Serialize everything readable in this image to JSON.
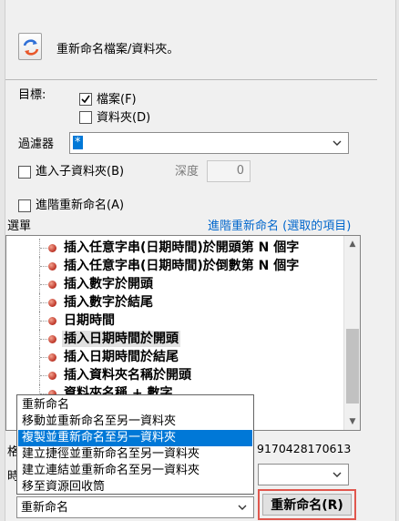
{
  "header": {
    "icon": "rename-refresh-icon",
    "title": "重新命名檔案/資料夾。"
  },
  "target": {
    "label": "目標:",
    "files_label": "檔案(F)",
    "files_checked": true,
    "folders_label": "資料夾(D)",
    "folders_checked": false
  },
  "filter": {
    "label": "過濾器",
    "value": "*"
  },
  "subfolders": {
    "label": "進入子資料夾(B)",
    "checked": false,
    "depth_label": "深度",
    "depth_value": "0"
  },
  "advanced": {
    "label": "進階重新命名(A)",
    "checked": false
  },
  "menu": {
    "label": "選單",
    "link": "進階重新命名 (選取的項目)",
    "items": [
      "插入任意字串(日期時間)於開頭第 N 個字",
      "插入任意字串(日期時間)於倒數第 N 個字",
      "插入數字於開頭",
      "插入數字於結尾",
      "日期時間",
      "插入日期時間於開頭",
      "插入日期時間於結尾",
      "插入資料夾名稱於開頭",
      "資料夾名稱 + 數字"
    ],
    "selected_index": 5
  },
  "partial": {
    "left1": "格",
    "left2": "時",
    "right_text": "9170428170613"
  },
  "dropdown": {
    "options": [
      "重新命名",
      "移動並重新命名至另一資料夾",
      "複製並重新命名至另一資料夾",
      "建立捷徑並重新命名至另一資料夾",
      "建立連結並重新命名至另一資料夾",
      "移至資源回收筒"
    ],
    "highlighted_index": 2,
    "selected": "重新命名"
  },
  "rename_button": {
    "label": "重新命名(R)"
  },
  "colors": {
    "accent": "#0078d7",
    "link": "#0066cc",
    "highlight_border": "#e0574e"
  }
}
